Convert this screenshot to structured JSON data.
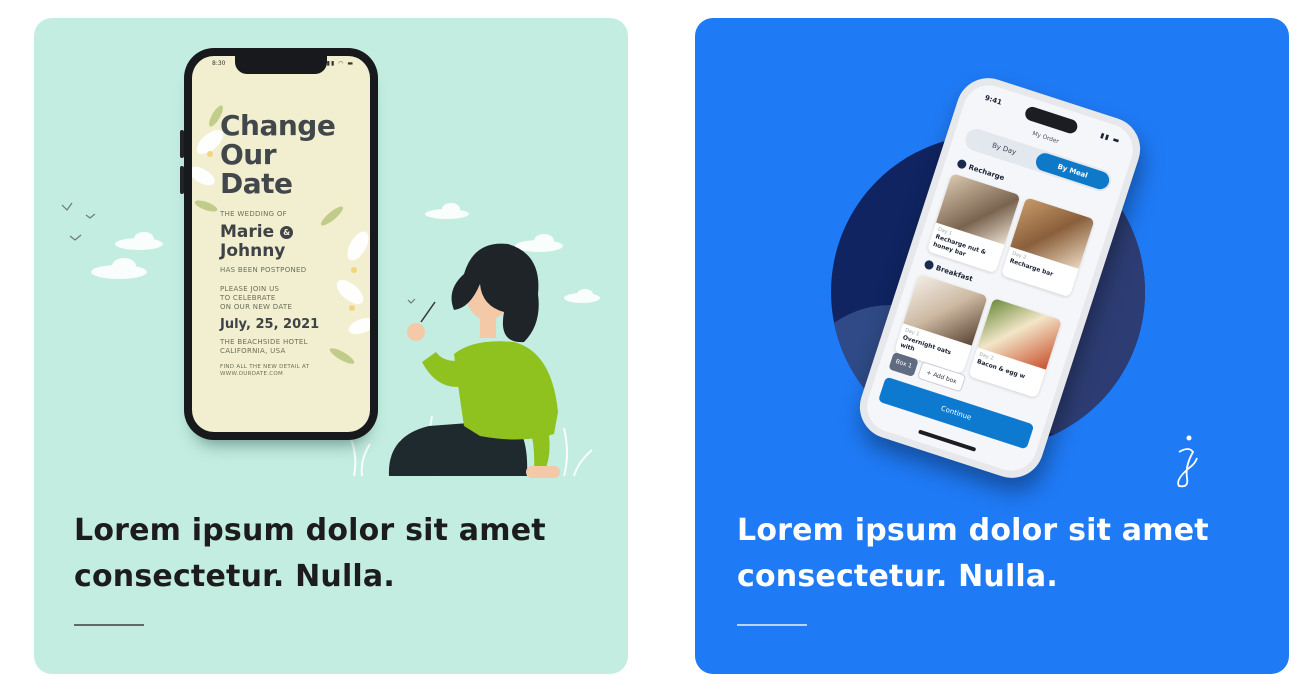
{
  "cards": [
    {
      "title_line1": "Lorem ipsum dolor sit amet",
      "title_line2": "consectetur. Nulla.",
      "phone": {
        "status_time": "8:30",
        "headline": [
          "Change",
          "Our",
          "Date"
        ],
        "wedding_of": "THE WEDDING OF",
        "name1": "Marie",
        "amp": "&",
        "name2": "Johnny",
        "postponed": "HAS BEEN POSTPONED",
        "please": [
          "PLEASE JOIN US",
          "TO CELEBRATE",
          "ON OUR NEW DATE"
        ],
        "date": "July, 25, 2021",
        "venue": [
          "THE BEACHSIDE HOTEL",
          "CALIFORNIA, USA"
        ],
        "find": [
          "FIND ALL THE NEW DETAIL AT",
          "WWW.OURDATE.COM"
        ]
      }
    },
    {
      "title_line1": "Lorem ipsum dolor sit amet",
      "title_line2": "consectetur. Nulla.",
      "phone": {
        "status_time": "9:41",
        "header": "My Order",
        "tab_by_day": "By Day",
        "tab_by_meal": "By Meal",
        "section1": "Recharge",
        "section2": "Breakfast",
        "items": [
          {
            "day": "Day 1",
            "name": "Recharge nut & honey bar"
          },
          {
            "day": "Day 2",
            "name": "Recharge bar"
          },
          {
            "day": "Day 1",
            "name": "Overnight oats with"
          },
          {
            "day": "Day 2",
            "name": "Bacon & egg w"
          }
        ],
        "box_tab": "Box 1",
        "add_box": "+ Add box",
        "continue_label": "Continue"
      }
    }
  ],
  "colors": {
    "left_card_bg": "#c2ede0",
    "right_card_bg": "#1f7af5",
    "accent_blue": "#0d7ad0",
    "dark_navy": "#0f2461"
  }
}
